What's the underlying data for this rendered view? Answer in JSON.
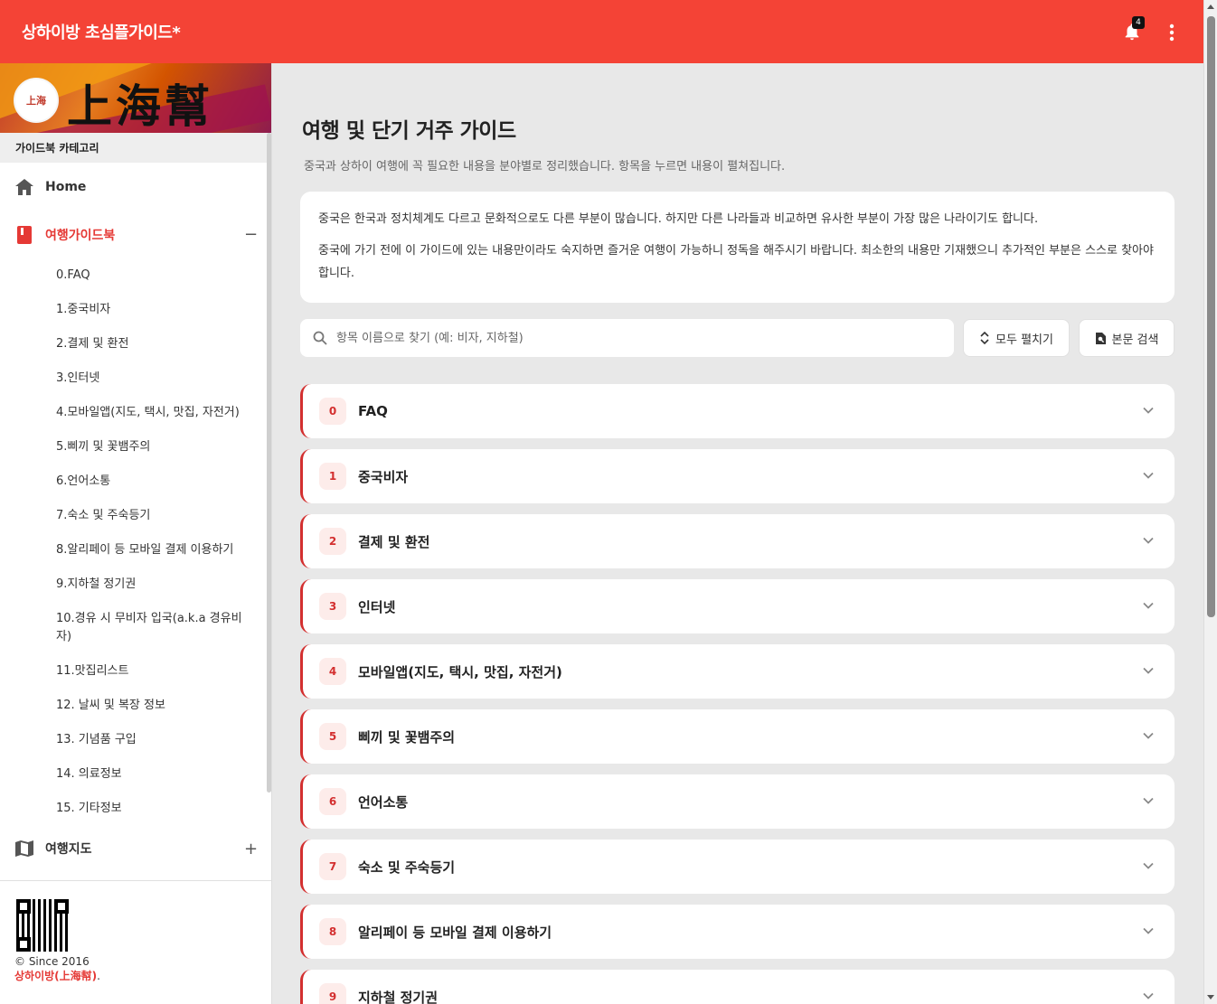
{
  "appbar": {
    "title": "상하이방 초심플가이드*",
    "notification_count": "4",
    "color": "#f44336"
  },
  "sidebar": {
    "banner_logo_text": "上海幫",
    "banner_badge_text": "上海",
    "category_header": "가이드북 카테고리",
    "home_label": "Home",
    "guidebook_label": "여행가이드북",
    "guidebook_toggle": "−",
    "guidebook_items": [
      "0.FAQ",
      "1.중국비자",
      "2.결제 및 환전",
      "3.인터넷",
      "4.모바일앱(지도, 택시, 맛집, 자전거)",
      "5.삐끼 및 꽃뱀주의",
      "6.언어소통",
      "7.숙소 및 주숙등기",
      "8.알리페이 등 모바일 결제 이용하기",
      "9.지하철 정기권",
      "10.경유 시 무비자 입국(a.k.a 경유비자)",
      "11.맛집리스트",
      "12. 날씨 및 복장 정보",
      "13. 기념품 구입",
      "14. 의료정보",
      "15. 기타정보"
    ],
    "map_label": "여행지도",
    "map_toggle": "+",
    "since": "© Since 2016",
    "brand": "상하이방(上海幇)",
    "brand_suffix": "."
  },
  "main": {
    "title": "여행 및 단기 거주 가이드",
    "subtitle": "중국과 상하이 여행에 꼭 필요한 내용을 분야별로 정리했습니다. 항목을 누르면 내용이 펼쳐집니다.",
    "intro_p1": "중국은 한국과 정치체계도 다르고 문화적으로도 다른 부분이 많습니다. 하지만 다른 나라들과 비교하면 유사한 부분이 가장 많은 나라이기도 합니다.",
    "intro_p2": "중국에 가기 전에 이 가이드에 있는 내용만이라도 숙지하면 즐거운 여행이 가능하니 정독을 해주시기 바랍니다. 최소한의 내용만 기재했으니 추가적인 부분은 스스로 찾아야 합니다.",
    "search_placeholder": "항목 이름으로 찾기 (예: 비자, 지하철)",
    "expand_all_label": "모두 펼치기",
    "search_body_label": "본문 검색",
    "sections": [
      {
        "num": "0",
        "label": "FAQ"
      },
      {
        "num": "1",
        "label": "중국비자"
      },
      {
        "num": "2",
        "label": "결제 및 환전"
      },
      {
        "num": "3",
        "label": "인터넷"
      },
      {
        "num": "4",
        "label": "모바일앱(지도, 택시, 맛집, 자전거)"
      },
      {
        "num": "5",
        "label": "삐끼 및 꽃뱀주의"
      },
      {
        "num": "6",
        "label": "언어소통"
      },
      {
        "num": "7",
        "label": "숙소 및 주숙등기"
      },
      {
        "num": "8",
        "label": "알리페이 등 모바일 결제 이용하기"
      },
      {
        "num": "9",
        "label": "지하철 정기권"
      }
    ],
    "accent": "#d32f2f"
  }
}
